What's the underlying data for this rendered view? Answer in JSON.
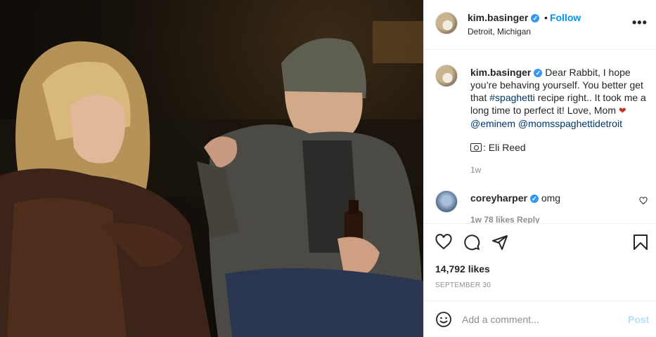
{
  "post": {
    "author": "kim.basinger",
    "follow_label": "Follow",
    "location": "Detroit, Michigan",
    "more_label": "•••",
    "separator": "•"
  },
  "caption": {
    "user": "kim.basinger",
    "text": "Dear Rabbit, I hope you’re behaving yourself. You better get that ",
    "hashtag": "#spaghetti",
    "text2": " recipe right.. It took me a long time to perfect it! Love, Mom ",
    "emoji": "❤",
    "mention1": "@eminem",
    "mention2": "@momsspaghettidetroit",
    "credit": ": Eli Reed",
    "time": "1w"
  },
  "reply": {
    "user": "coreyharper",
    "text": "omg",
    "meta": "1w   78 likes   Reply"
  },
  "engagement": {
    "likes": "14,792 likes",
    "date": "SEPTEMBER 30"
  },
  "add_comment": {
    "placeholder": "Add a comment...",
    "post_label": "Post"
  },
  "colors": {
    "accent": "#0095f6",
    "verified": "#3897f0",
    "muted": "#8e8e8e",
    "post_disabled": "#b2dffc"
  },
  "icons": {
    "like": "heart-icon",
    "comment": "comment-icon",
    "share": "paper-plane-icon",
    "save": "bookmark-icon",
    "emoji": "smiley-icon",
    "more": "ellipsis-icon"
  }
}
